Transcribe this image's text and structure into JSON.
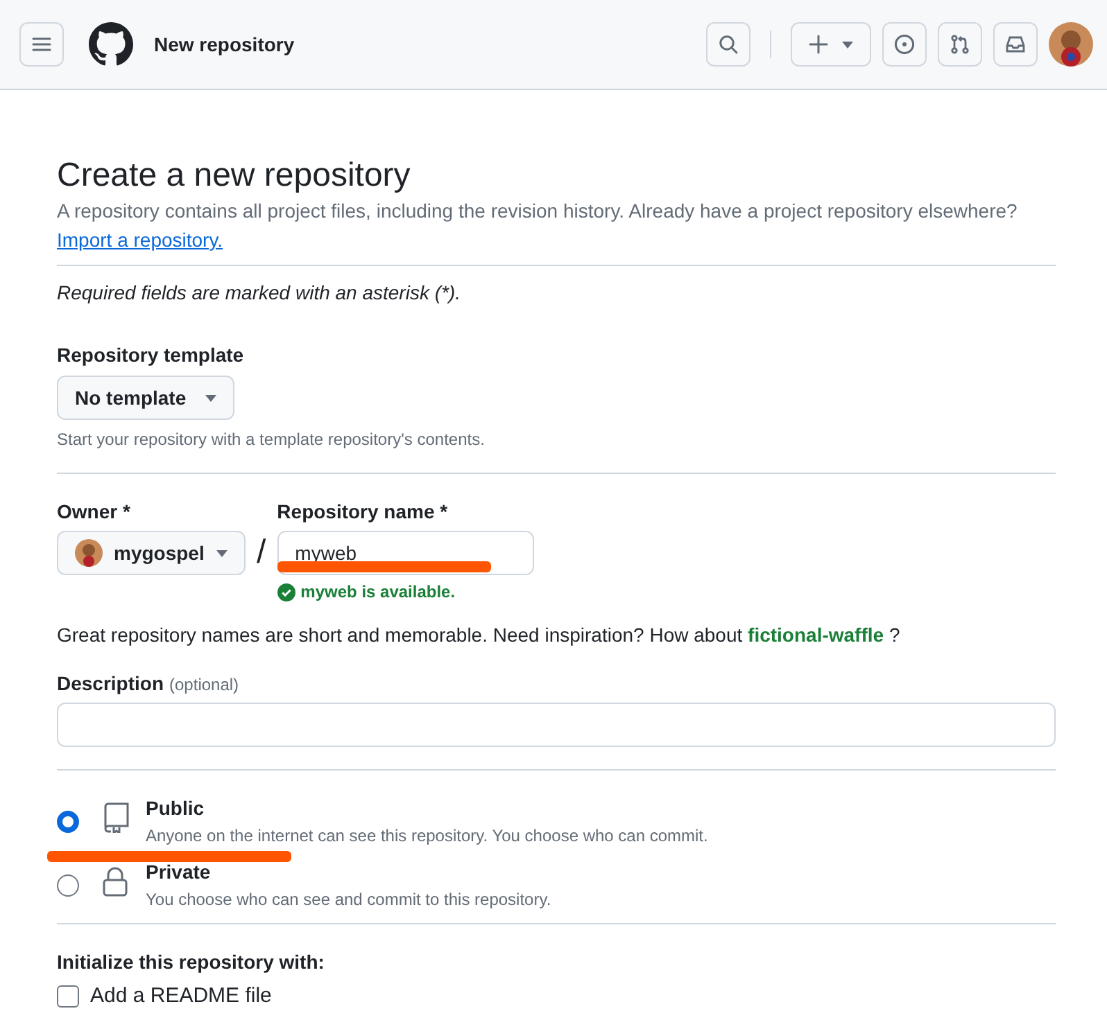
{
  "header": {
    "title": "New repository"
  },
  "page": {
    "title": "Create a new repository",
    "intro": "A repository contains all project files, including the revision history. Already have a project repository elsewhere?",
    "import_link": "Import a repository.",
    "required_note": "Required fields are marked with an asterisk (*)."
  },
  "template": {
    "label": "Repository template",
    "value": "No template",
    "hint": "Start your repository with a template repository's contents."
  },
  "owner": {
    "label": "Owner *",
    "value": "mygospel"
  },
  "separator": "/",
  "repo_name": {
    "label": "Repository name *",
    "value": "myweb",
    "status": "myweb is available."
  },
  "suggestion": {
    "text": "Great repository names are short and memorable. Need inspiration? How about",
    "name": "fictional-waffle",
    "end": "?"
  },
  "description": {
    "label": "Description",
    "optional": "(optional)"
  },
  "visibility": [
    {
      "kind": "public",
      "label": "Public",
      "hint": "Anyone on the internet can see this repository. You choose who can commit.",
      "selected": true
    },
    {
      "kind": "private",
      "label": "Private",
      "hint": "You choose who can see and commit to this repository.",
      "selected": false
    }
  ],
  "initialize": {
    "label": "Initialize this repository with:",
    "options": [
      {
        "label": "Add a README file",
        "checked": false
      }
    ]
  }
}
